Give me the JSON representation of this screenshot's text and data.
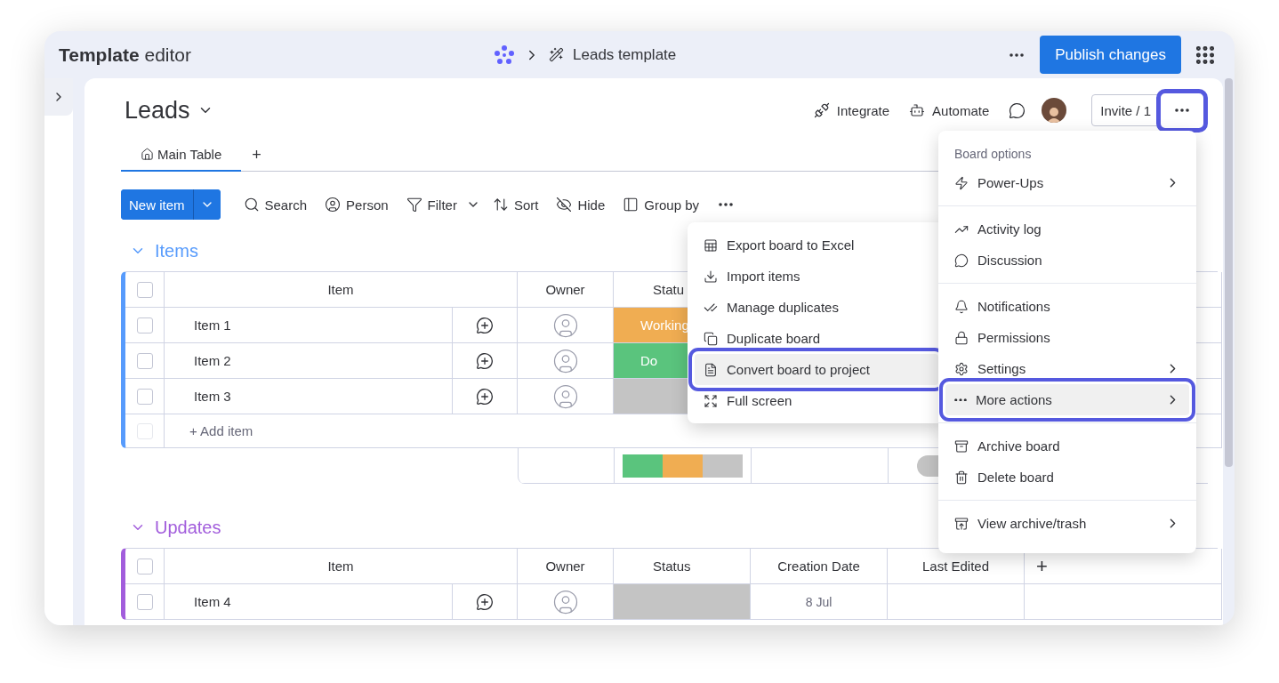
{
  "top_bar": {
    "title": "**Template** editor",
    "breadcrumb": "Leads template",
    "publish_button": "Publish changes"
  },
  "board": {
    "title": "Leads",
    "actions": [
      "Integrate",
      "Automate"
    ],
    "invite_button": "Invite / 1",
    "more_button": {
      "highlighted": true
    }
  },
  "tabs": [
    {
      "label": "Main Table",
      "selected": true
    }
  ],
  "add_view": "+",
  "toolbar": {
    "new_item": "New item",
    "tools": [
      {
        "label": "Search",
        "dropdown": false
      },
      {
        "label": "Person",
        "dropdown": false
      },
      {
        "label": "Filter",
        "dropdown": true
      },
      {
        "label": "Sort",
        "dropdown": false
      },
      {
        "label": "Hide",
        "dropdown": false
      },
      {
        "label": "Group by",
        "dropdown": false
      }
    ]
  },
  "groups": [
    {
      "title": "Items",
      "color": "#579bfc",
      "columns": [
        "Item",
        "Owner",
        "Statu"
      ],
      "header_checkbox": {
        "checked": false
      },
      "rows": [
        {
          "name": "Item 1",
          "checked": false,
          "status": {
            "label": "Working",
            "color": "#f0ad52"
          }
        },
        {
          "name": "Item 2",
          "checked": false,
          "status": {
            "label": "Do",
            "color": "#5ac47d"
          }
        },
        {
          "name": "Item 3",
          "checked": false,
          "status": {
            "color": "#c4c4c4"
          }
        }
      ],
      "add_item": "+ Add item",
      "add_item_checkbox": {
        "checked": false
      },
      "summary": [
        {
          "color": "#5ac47d"
        },
        {
          "color": "#f0ad52"
        },
        {
          "color": "#c4c4c4"
        }
      ]
    },
    {
      "title": "Updates",
      "color": "#a25ddc",
      "columns": [
        "Item",
        "Owner",
        "Status",
        "Creation Date",
        "Last Edited"
      ],
      "add_column": "+",
      "header_checkbox": {
        "checked": false
      },
      "rows": [
        {
          "name": "Item 4",
          "checked": false,
          "status": {
            "color": "#c4c4c4"
          },
          "creation_date": "8 Jul"
        }
      ]
    }
  ],
  "more_actions_menu": {
    "items": [
      {
        "label": "Export board to Excel",
        "highlighted": false
      },
      {
        "label": "Import items",
        "highlighted": false
      },
      {
        "label": "Manage duplicates",
        "highlighted": false
      },
      {
        "label": "Duplicate board",
        "highlighted": false
      },
      {
        "label": "Convert board to project",
        "highlighted": true
      },
      {
        "label": "Full screen",
        "highlighted": false
      }
    ]
  },
  "board_menu": {
    "title": "Board options",
    "sections": [
      {
        "items": [
          {
            "label": "Power-Ups",
            "submenu": true,
            "highlighted": false
          }
        ]
      },
      {
        "items": [
          {
            "label": "Activity log",
            "submenu": false,
            "highlighted": false
          },
          {
            "label": "Discussion",
            "submenu": false,
            "highlighted": false
          }
        ]
      },
      {
        "items": [
          {
            "label": "Notifications",
            "submenu": false,
            "highlighted": false
          },
          {
            "label": "Permissions",
            "submenu": false,
            "highlighted": false
          },
          {
            "label": "Settings",
            "submenu": true,
            "highlighted": false
          },
          {
            "label": "More actions",
            "submenu": true,
            "highlighted": true
          }
        ]
      },
      {
        "items": [
          {
            "label": "Archive board",
            "submenu": false,
            "highlighted": false
          },
          {
            "label": "Delete board",
            "submenu": false,
            "highlighted": false
          }
        ]
      },
      {
        "items": [
          {
            "label": "View archive/trash",
            "submenu": true,
            "highlighted": false
          }
        ]
      }
    ]
  }
}
